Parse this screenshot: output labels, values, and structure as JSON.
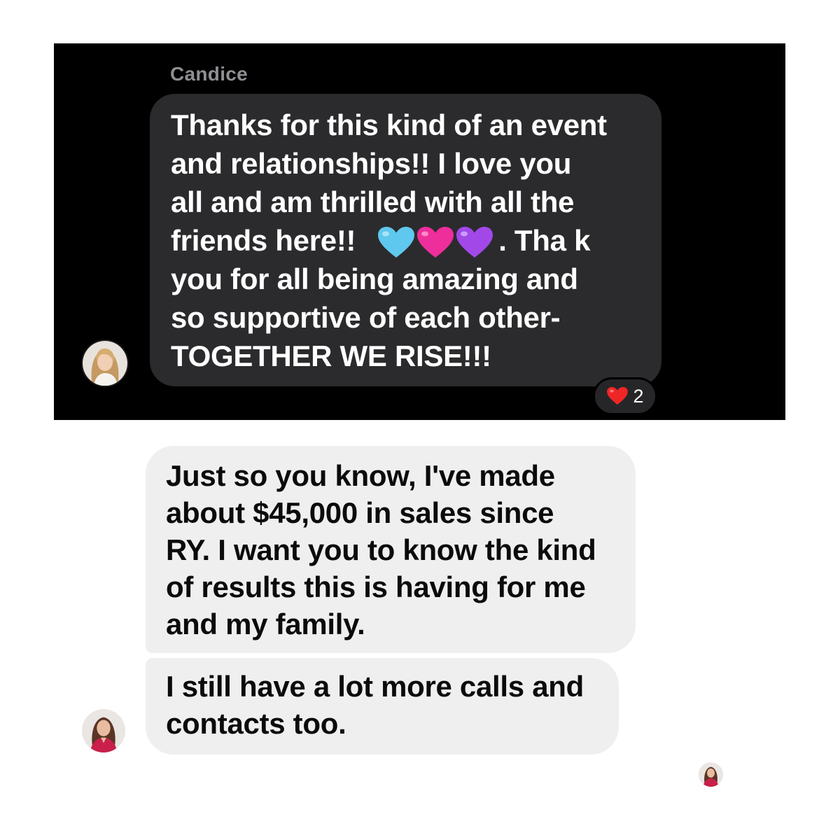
{
  "conversation_top": {
    "sender_name": "Candice",
    "message_lines": [
      "Thanks for this kind of an event",
      "and relationships!!  I love you",
      "all and am thrilled with all the",
      "friends here!!",
      ". Tha k",
      "you for all being amazing and",
      "so supportive of each other-",
      "TOGETHER WE RISE!!!"
    ],
    "emoji_icons": [
      "light-blue-heart-icon",
      "pink-heart-icon",
      "purple-heart-icon"
    ],
    "reaction": {
      "icon": "red-heart-icon",
      "count": "2"
    },
    "colors": {
      "background": "#000000",
      "bubble": "#2b2b2d",
      "text": "#ffffff",
      "sender_name": "#8e8e93"
    }
  },
  "conversation_bottom": {
    "messages": [
      {
        "lines": [
          "Just so you know, I've made",
          "about $45,000 in sales since",
          "RY. I want you to know the kind",
          "of results this is having for me",
          "and my family."
        ]
      },
      {
        "lines": [
          "I still have a lot more calls and",
          "contacts too."
        ]
      }
    ],
    "colors": {
      "background": "#ffffff",
      "bubble": "#efefef",
      "text": "#0b0b0b"
    }
  }
}
